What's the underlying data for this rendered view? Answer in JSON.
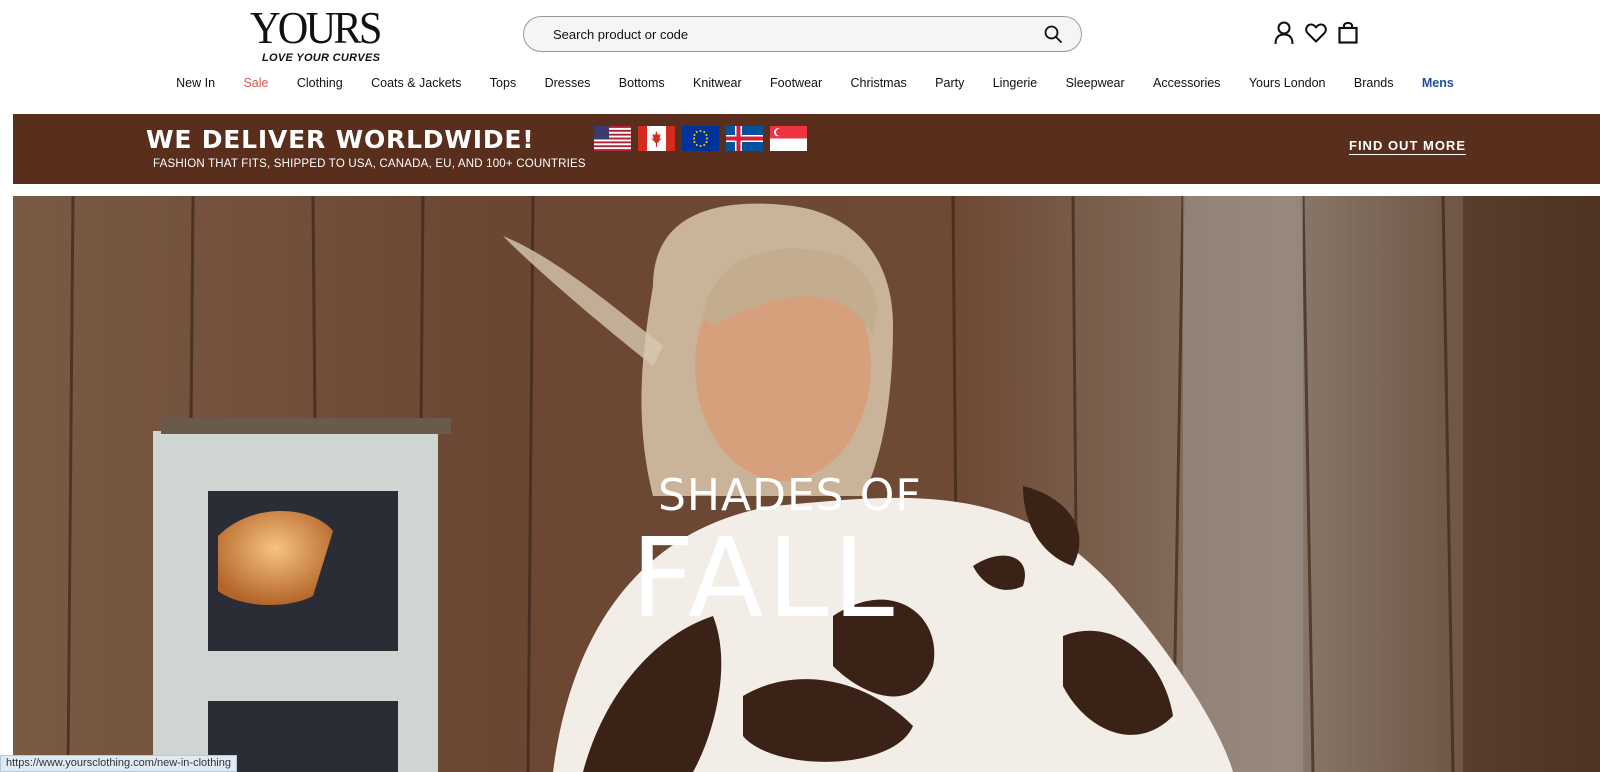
{
  "header": {
    "logo_text": "YOURS",
    "logo_tagline": "LOVE YOUR CURVES",
    "search": {
      "placeholder": "Search product or code"
    },
    "icons": [
      "account-icon",
      "heart-icon",
      "shopping-bag-icon"
    ]
  },
  "nav": {
    "items": [
      {
        "label": "New In"
      },
      {
        "label": "Sale",
        "color": "#d9534f"
      },
      {
        "label": "Clothing"
      },
      {
        "label": "Coats & Jackets"
      },
      {
        "label": "Tops"
      },
      {
        "label": "Dresses"
      },
      {
        "label": "Bottoms"
      },
      {
        "label": "Knitwear"
      },
      {
        "label": "Footwear"
      },
      {
        "label": "Christmas"
      },
      {
        "label": "Party"
      },
      {
        "label": "Lingerie"
      },
      {
        "label": "Sleepwear"
      },
      {
        "label": "Accessories"
      },
      {
        "label": "Yours London"
      },
      {
        "label": "Brands"
      },
      {
        "label": "Mens",
        "color": "#1a4f9c"
      }
    ]
  },
  "promo": {
    "title": "WE DELIVER WORLDWIDE!",
    "subtitle": "FASHION THAT FITS, SHIPPED TO USA, CANADA, EU, AND 100+ COUNTRIES",
    "flags": [
      "usa-flag-icon",
      "canada-flag-icon",
      "eu-flag-icon",
      "iceland-flag-icon",
      "singapore-flag-icon"
    ],
    "link_label": "FIND OUT MORE",
    "background": "#5a2e1c"
  },
  "hero": {
    "line1": "SHADES OF",
    "line2": "FALL"
  },
  "status_bar": {
    "url": "https://www.yoursclothing.com/new-in-clothing"
  }
}
